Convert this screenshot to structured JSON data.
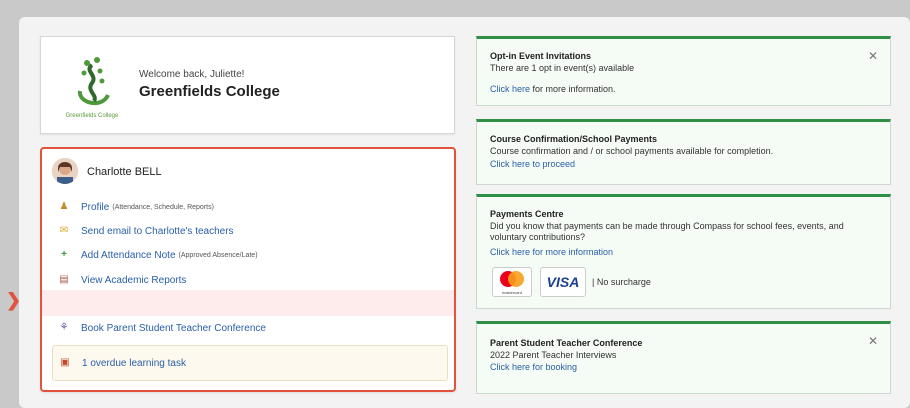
{
  "welcome": {
    "greeting": "Welcome back, Juliette!",
    "school_name": "Greenfields College",
    "logo_text": "Greenfields College"
  },
  "student": {
    "name": "Charlotte BELL",
    "links": [
      {
        "label": "Profile",
        "sub": "(Attendance, Schedule, Reports)",
        "icon": "profile-icon"
      },
      {
        "label": "Send email to Charlotte's teachers",
        "sub": "",
        "icon": "email-icon"
      },
      {
        "label": "Add Attendance Note",
        "sub": "(Approved Absence/Late)",
        "icon": "plus-icon"
      },
      {
        "label": "View Academic Reports",
        "sub": "",
        "icon": "report-icon"
      },
      {
        "label": "Book Parent Student Teacher Conference",
        "sub": "",
        "icon": "conference-icon"
      }
    ],
    "overdue": "1 overdue learning task"
  },
  "cards": {
    "optin": {
      "title": "Opt-in Event Invitations",
      "body": "There are 1 opt in event(s) available",
      "link": "Click here",
      "link_suffix": " for more information."
    },
    "course": {
      "title": "Course Confirmation/School Payments",
      "body": "Course confirmation and / or school payments available for completion.",
      "link": "Click here to proceed"
    },
    "payments": {
      "title": "Payments Centre",
      "body": "Did you know that payments can be made through Compass for school fees, events, and voluntary contributions?",
      "link": "Click here for more information",
      "visa": "VISA",
      "mc_label": "mastercard",
      "surcharge": "No surcharge"
    },
    "conference": {
      "title": "Parent Student Teacher Conference",
      "body": "2022 Parent Teacher Interviews",
      "link": "Click here for booking"
    }
  },
  "colors": {
    "accent": "#e0533c",
    "green": "#2f8f47",
    "link": "#2a5fa8"
  }
}
